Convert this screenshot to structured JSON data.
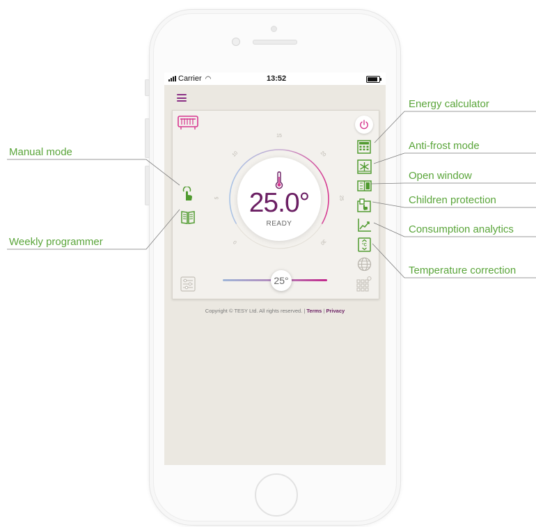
{
  "status_bar": {
    "carrier": "Carrier",
    "time": "13:52"
  },
  "dial": {
    "temperature": "25.0°",
    "status": "READY",
    "scale_ticks": [
      "0",
      "5",
      "10",
      "15",
      "20",
      "25",
      "30"
    ]
  },
  "slider": {
    "value_label": "25°",
    "fraction": 0.56
  },
  "footer": {
    "copyright": "Copyright © TESY Ltd. All rights reserved. |",
    "terms": "Terms",
    "separator": "|",
    "privacy": "Privacy"
  },
  "callouts": {
    "energy_calculator": "Energy calculator",
    "anti_frost_mode": "Anti-frost mode",
    "open_window": "Open window",
    "children_protection": "Children protection",
    "consumption_analytics": "Consumption analytics",
    "temperature_correction": "Temperature correction",
    "manual_mode": "Manual mode",
    "weekly_programmer": "Weekly programmer"
  },
  "icons": {
    "menu": "hamburger-menu-icon",
    "heater": "convector-heater-icon",
    "power": "power-icon",
    "calculator": "calculator-icon",
    "anti_frost": "snowflake-icon",
    "open_window": "open-window-icon",
    "child_lock": "child-lock-icon",
    "analytics": "line-chart-icon",
    "temp_correction": "temperature-correction-icon",
    "globe": "globe-icon",
    "settings": "settings-sliders-icon",
    "grid": "grid-gear-icon",
    "manual": "hand-pointer-icon",
    "weekly": "book-icon",
    "thermometer": "thermometer-icon"
  },
  "colors": {
    "accent_purple": "#6b1f63",
    "accent_pink": "#c2278c",
    "icon_green": "#4f9a2f",
    "callout_green": "#5aa53a",
    "screen_bg": "#ebe8e1"
  }
}
